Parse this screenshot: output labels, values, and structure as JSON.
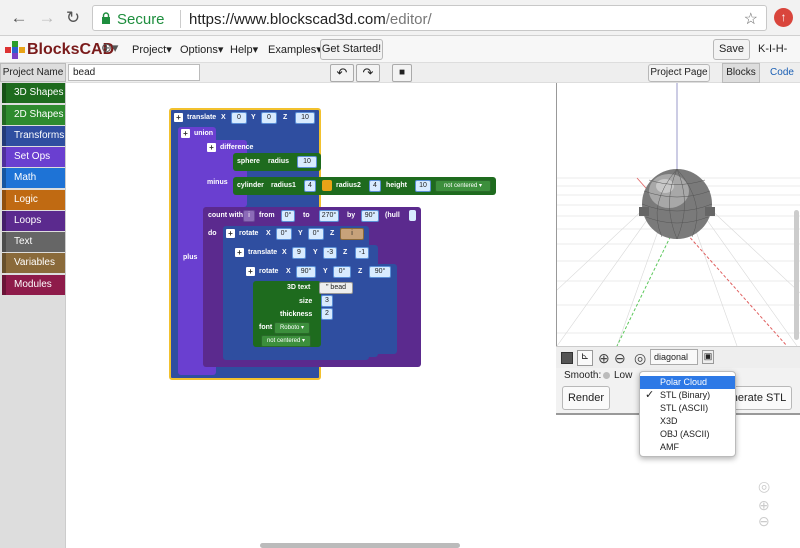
{
  "browser": {
    "secure_label": "Secure",
    "url_host": "https://www.blockscad3d.com",
    "url_path": "/editor/"
  },
  "app": {
    "logo_text": "BlocksCAD",
    "menus": [
      "Project",
      "Options",
      "Help",
      "Examples"
    ],
    "get_started": "Get Started!",
    "save": "Save",
    "user": "K-I-H-"
  },
  "project": {
    "label": "Project Name",
    "name": "bead",
    "project_page": "Project Page",
    "tab_blocks": "Blocks",
    "tab_code": "Code"
  },
  "toolbox": [
    {
      "label": "3D Shapes",
      "color": "#1e6b1e"
    },
    {
      "label": "2D Shapes",
      "color": "#2e8b2e"
    },
    {
      "label": "Transforms",
      "color": "#2f4ea0"
    },
    {
      "label": "Set Ops",
      "color": "#6a3fd0"
    },
    {
      "label": "Math",
      "color": "#1e73d6"
    },
    {
      "label": "Logic",
      "color": "#c06a12"
    },
    {
      "label": "Loops",
      "color": "#5b2a8e"
    },
    {
      "label": "Text",
      "color": "#666666"
    },
    {
      "label": "Variables",
      "color": "#8a6a3a"
    },
    {
      "label": "Modules",
      "color": "#8e1b4a"
    }
  ],
  "blocks": {
    "translate": "translate",
    "x": "X",
    "y": "Y",
    "z": "Z",
    "t_x": "0",
    "t_y": "0",
    "t_z": "10",
    "union": "union",
    "difference": "difference",
    "sphere": "sphere",
    "radius": "radius",
    "sphere_r": "10",
    "minus": "minus",
    "cylinder": "cylinder",
    "radius1": "radius1",
    "r1": "4",
    "radius2": "radius2",
    "r2": "4",
    "height": "height",
    "h": "10",
    "not_centered": "not centered",
    "plus": "plus",
    "count_with": "count with",
    "var_i": "i",
    "from": "from",
    "from_v": "0°",
    "to": "to",
    "to_v": "270°",
    "by": "by",
    "by_v": "90°",
    "hull": "(hull",
    "do": "do",
    "rotate": "rotate",
    "r_x": "0°",
    "r_y": "0°",
    "translate2_x": "9",
    "translate2_y": "-3",
    "translate2_z": "-1",
    "rotate2_x": "90°",
    "rotate2_y": "0°",
    "rotate2_z": "90°",
    "text3d": "3D text",
    "text_v": "bead",
    "size": "size",
    "size_v": "3",
    "thickness": "thickness",
    "thick_v": "2",
    "font": "font",
    "font_v": "Roboto",
    "not_centered2": "not centered"
  },
  "viewer": {
    "view_select": "diagonal",
    "smooth_label": "Smooth:",
    "smooth_low": "Low",
    "render": "Render",
    "generate": "nerate STL"
  },
  "dropdown": {
    "items": [
      "Polar Cloud",
      "STL (Binary)",
      "STL (ASCII)",
      "X3D",
      "OBJ (ASCII)",
      "AMF"
    ],
    "highlighted": "Polar Cloud",
    "checked": "STL (Binary)"
  }
}
